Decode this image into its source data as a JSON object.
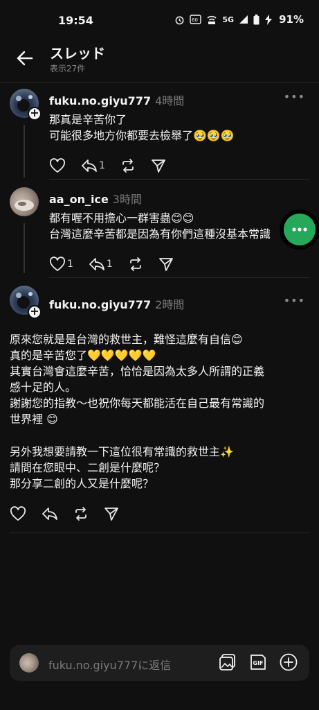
{
  "status_bar": {
    "time": "19:54",
    "battery_percent": "91%",
    "network": "5G"
  },
  "header": {
    "title": "スレッド",
    "subtitle": "表示27件"
  },
  "posts": [
    {
      "username": "fuku.no.giyu777",
      "time": "4時間",
      "text": "那真是辛苦你了\n可能很多地方你都要去檢舉了🥹🥹🥹",
      "reposts": "1"
    },
    {
      "username": "aa_on_ice",
      "time": "3時間",
      "text": "都有喔不用擔心一群害蟲😊😊\n台灣這麼辛苦都是因為有你們這種沒基本常識",
      "likes": "1",
      "reposts": "1"
    },
    {
      "username": "fuku.no.giyu777",
      "time": "2時間",
      "text": "原來您就是是台灣的救世主，難怪這麼有自信😊\n真的是辛苦您了💛💛💛💛💛\n其實台灣會這麼辛苦，恰恰是因為太多人所謂的正義\n感十足的人。\n謝謝您的指教～也祝你每天都能活在自己最有常識的\n世界裡 😊",
      "text2": "另外我想要請教一下這位很有常識的救世主✨\n請問在您眼中、二創是什麼呢？\n那分享二創的人又是什麼呢？"
    }
  ],
  "more_label": "•••",
  "plus_label": "+",
  "reply_bar": {
    "placeholder": "fuku.no.giyu777に返信"
  },
  "colors": {
    "background": "#101010",
    "fab": "#26a85a",
    "text": "#f3f3f3",
    "muted": "#7a7a7a"
  }
}
